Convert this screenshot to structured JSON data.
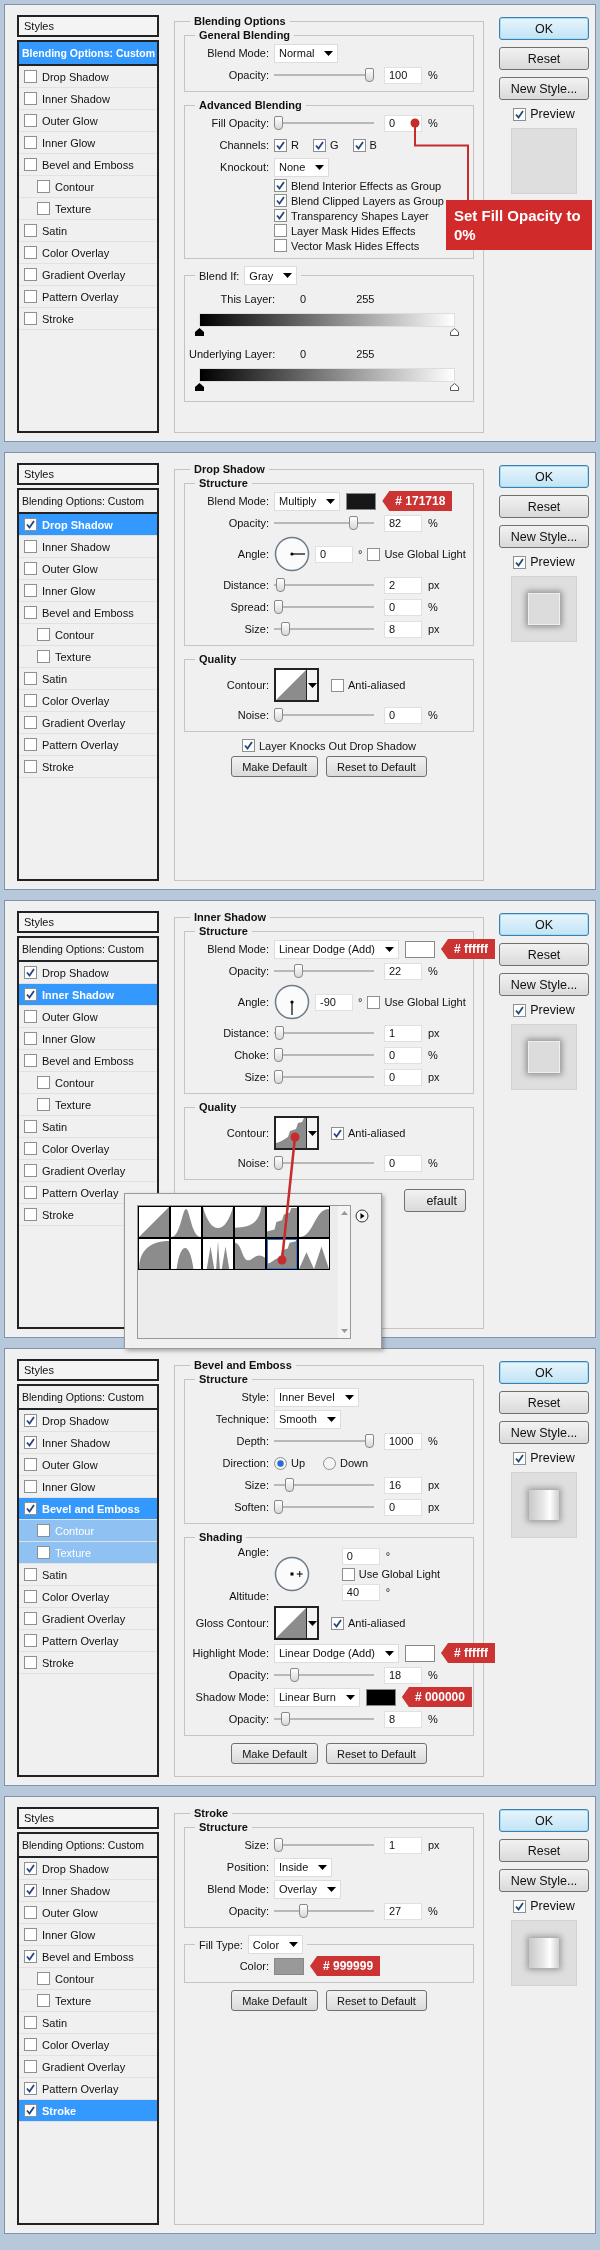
{
  "dialogs": [
    {
      "styles": {
        "header": "Styles",
        "options": {
          "label": "Blending Options: Custom",
          "selected": true
        },
        "effects": [
          {
            "label": "Drop Shadow",
            "kind": "effect",
            "checked": false,
            "selected": false
          },
          {
            "label": "Inner Shadow",
            "kind": "effect",
            "checked": false,
            "selected": false
          },
          {
            "label": "Outer Glow",
            "kind": "effect",
            "checked": false,
            "selected": false
          },
          {
            "label": "Inner Glow",
            "kind": "effect",
            "checked": false,
            "selected": false
          },
          {
            "label": "Bevel and Emboss",
            "kind": "effect",
            "checked": false,
            "selected": false
          },
          {
            "label": "Contour",
            "kind": "sub",
            "checked": false,
            "selected": false
          },
          {
            "label": "Texture",
            "kind": "sub",
            "checked": false,
            "selected": false
          },
          {
            "label": "Satin",
            "kind": "effect",
            "checked": false,
            "selected": false
          },
          {
            "label": "Color Overlay",
            "kind": "effect",
            "checked": false,
            "selected": false
          },
          {
            "label": "Gradient Overlay",
            "kind": "effect",
            "checked": false,
            "selected": false
          },
          {
            "label": "Pattern Overlay",
            "kind": "effect",
            "checked": false,
            "selected": false
          },
          {
            "label": "Stroke",
            "kind": "effect",
            "checked": false,
            "selected": false
          }
        ]
      },
      "panel": {
        "title": "Blending Options",
        "groups": [
          {
            "title": "General Blending",
            "rows": [
              {
                "kind": "select",
                "label": "Blend Mode:",
                "value": "Normal"
              },
              {
                "kind": "slider",
                "label": "Opacity:",
                "level": 1,
                "value": "100",
                "unit": "%"
              }
            ]
          },
          {
            "title": "Advanced Blending",
            "rows": [
              {
                "kind": "slider",
                "label": "Fill Opacity:",
                "level": 0,
                "value": "0",
                "unit": "%",
                "callout": {
                  "text": "Set Fill Opacity to 0%"
                }
              },
              {
                "kind": "channels",
                "label": "Channels:",
                "options": [
                  {
                    "label": "R",
                    "checked": true
                  },
                  {
                    "label": "G",
                    "checked": true
                  },
                  {
                    "label": "B",
                    "checked": true
                  }
                ]
              },
              {
                "kind": "select",
                "label": "Knockout:",
                "value": "None"
              },
              {
                "kind": "checkbox",
                "label": "Blend Interior Effects as Group",
                "checked": true
              },
              {
                "kind": "checkbox",
                "label": "Blend Clipped Layers as Group",
                "checked": true
              },
              {
                "kind": "checkbox",
                "label": "Transparency Shapes Layer",
                "checked": true
              },
              {
                "kind": "checkbox",
                "label": "Layer Mask Hides Effects",
                "checked": false
              },
              {
                "kind": "checkbox",
                "label": "Vector Mask Hides Effects",
                "checked": false
              }
            ]
          },
          {
            "legend": {
              "label": "Blend If:",
              "value": "Gray"
            },
            "rows": [
              {
                "kind": "gradient",
                "label": "This Layer:",
                "min": "0",
                "max": "255"
              },
              {
                "kind": "gradient",
                "label": "Underlying Layer:",
                "min": "0",
                "max": "255"
              }
            ]
          }
        ]
      },
      "buttons": [
        {
          "label": "OK",
          "default": true
        },
        {
          "label": "Reset",
          "default": false
        },
        {
          "label": "New Style...",
          "default": false
        }
      ],
      "preview": {
        "label": "Preview",
        "checked": true,
        "kind": "empty"
      }
    },
    {
      "styles": {
        "header": "Styles",
        "options": {
          "label": "Blending Options: Custom",
          "selected": false
        },
        "effects": [
          {
            "label": "Drop Shadow",
            "kind": "effect",
            "checked": true,
            "selected": true
          },
          {
            "label": "Inner Shadow",
            "kind": "effect",
            "checked": false,
            "selected": false
          },
          {
            "label": "Outer Glow",
            "kind": "effect",
            "checked": false,
            "selected": false
          },
          {
            "label": "Inner Glow",
            "kind": "effect",
            "checked": false,
            "selected": false
          },
          {
            "label": "Bevel and Emboss",
            "kind": "effect",
            "checked": false,
            "selected": false
          },
          {
            "label": "Contour",
            "kind": "sub",
            "checked": false,
            "selected": false
          },
          {
            "label": "Texture",
            "kind": "sub",
            "checked": false,
            "selected": false
          },
          {
            "label": "Satin",
            "kind": "effect",
            "checked": false,
            "selected": false
          },
          {
            "label": "Color Overlay",
            "kind": "effect",
            "checked": false,
            "selected": false
          },
          {
            "label": "Gradient Overlay",
            "kind": "effect",
            "checked": false,
            "selected": false
          },
          {
            "label": "Pattern Overlay",
            "kind": "effect",
            "checked": false,
            "selected": false
          },
          {
            "label": "Stroke",
            "kind": "effect",
            "checked": false,
            "selected": false
          }
        ]
      },
      "panel": {
        "title": "Drop Shadow",
        "groups": [
          {
            "title": "Structure",
            "rows": [
              {
                "kind": "select",
                "label": "Blend Mode:",
                "value": "Multiply",
                "swatch": {
                  "color": "#171718",
                  "tag": "# 171718"
                }
              },
              {
                "kind": "slider",
                "label": "Opacity:",
                "level": 0.82,
                "value": "82",
                "unit": "%"
              },
              {
                "kind": "angle",
                "label": "Angle:",
                "value": "0",
                "unit": "°",
                "checkbox": {
                  "label": "Use Global Light",
                  "checked": false
                }
              },
              {
                "kind": "slider",
                "label": "Distance:",
                "level": 0.02,
                "value": "2",
                "unit": "px"
              },
              {
                "kind": "slider",
                "label": "Spread:",
                "level": 0,
                "value": "0",
                "unit": "%"
              },
              {
                "kind": "slider",
                "label": "Size:",
                "level": 0.08,
                "value": "8",
                "unit": "px"
              }
            ]
          },
          {
            "title": "Quality",
            "rows": [
              {
                "kind": "contour",
                "label": "Contour:",
                "curve": {
                  "kind": "linear"
                },
                "checkbox": {
                  "label": "Anti-aliased",
                  "checked": false
                }
              },
              {
                "kind": "slider",
                "label": "Noise:",
                "level": 0,
                "value": "0",
                "unit": "%"
              }
            ]
          }
        ],
        "footer": {
          "checkbox": {
            "label": "Layer Knocks Out Drop Shadow",
            "checked": true
          },
          "buttons": [
            {
              "label": "Make Default"
            },
            {
              "label": "Reset to Default"
            }
          ]
        }
      },
      "buttons": [
        {
          "label": "OK",
          "default": true
        },
        {
          "label": "Reset",
          "default": false
        },
        {
          "label": "New Style...",
          "default": false
        }
      ],
      "preview": {
        "label": "Preview",
        "checked": true,
        "kind": "shadow"
      }
    },
    {
      "styles": {
        "header": "Styles",
        "options": {
          "label": "Blending Options: Custom",
          "selected": false
        },
        "effects": [
          {
            "label": "Drop Shadow",
            "kind": "effect",
            "checked": true,
            "selected": false
          },
          {
            "label": "Inner Shadow",
            "kind": "effect",
            "checked": true,
            "selected": true
          },
          {
            "label": "Outer Glow",
            "kind": "effect",
            "checked": false,
            "selected": false
          },
          {
            "label": "Inner Glow",
            "kind": "effect",
            "checked": false,
            "selected": false
          },
          {
            "label": "Bevel and Emboss",
            "kind": "effect",
            "checked": false,
            "selected": false
          },
          {
            "label": "Contour",
            "kind": "sub",
            "checked": false,
            "selected": false
          },
          {
            "label": "Texture",
            "kind": "sub",
            "checked": false,
            "selected": false
          },
          {
            "label": "Satin",
            "kind": "effect",
            "checked": false,
            "selected": false
          },
          {
            "label": "Color Overlay",
            "kind": "effect",
            "checked": false,
            "selected": false
          },
          {
            "label": "Gradient Overlay",
            "kind": "effect",
            "checked": false,
            "selected": false
          },
          {
            "label": "Pattern Overlay",
            "kind": "effect",
            "checked": false,
            "selected": false
          },
          {
            "label": "Stroke",
            "kind": "effect",
            "checked": false,
            "selected": false
          }
        ]
      },
      "panel": {
        "title": "Inner Shadow",
        "groups": [
          {
            "title": "Structure",
            "rows": [
              {
                "kind": "select",
                "label": "Blend Mode:",
                "value": "Linear Dodge (Add)",
                "swatch": {
                  "color": "#ffffff",
                  "tag": "# ffffff"
                }
              },
              {
                "kind": "slider",
                "label": "Opacity:",
                "level": 0.22,
                "value": "22",
                "unit": "%"
              },
              {
                "kind": "angle",
                "label": "Angle:",
                "value": "-90",
                "unit": "°",
                "checkbox": {
                  "label": "Use Global Light",
                  "checked": false
                }
              },
              {
                "kind": "slider",
                "label": "Distance:",
                "level": 0.01,
                "value": "1",
                "unit": "px"
              },
              {
                "kind": "slider",
                "label": "Choke:",
                "level": 0,
                "value": "0",
                "unit": "%"
              },
              {
                "kind": "slider",
                "label": "Size:",
                "level": 0,
                "value": "0",
                "unit": "px"
              }
            ]
          },
          {
            "title": "Quality",
            "rows": [
              {
                "kind": "contour",
                "label": "Contour:",
                "curve": {
                  "kind": "rolling"
                },
                "pointer": true,
                "checkbox": {
                  "label": "Anti-aliased",
                  "checked": true
                }
              },
              {
                "kind": "slider",
                "label": "Noise:",
                "level": 0,
                "value": "0",
                "unit": "%"
              }
            ]
          }
        ],
        "footer": {
          "buttons": [
            {
              "label": "efault",
              "kind": "partial"
            }
          ]
        }
      },
      "popup": {
        "kind": "contour-picker",
        "presets": [
          {
            "selected": false
          },
          {
            "selected": false
          },
          {
            "selected": false
          },
          {
            "selected": false
          },
          {
            "selected": false
          },
          {
            "selected": false
          },
          {
            "selected": false
          },
          {
            "selected": false
          },
          {
            "selected": false
          },
          {
            "selected": false
          },
          {
            "selected": true
          },
          {
            "selected": false
          }
        ]
      },
      "buttons": [
        {
          "label": "OK",
          "default": true
        },
        {
          "label": "Reset",
          "default": false
        },
        {
          "label": "New Style...",
          "default": false
        }
      ],
      "preview": {
        "label": "Preview",
        "checked": true,
        "kind": "shadow"
      }
    },
    {
      "styles": {
        "header": "Styles",
        "options": {
          "label": "Blending Options: Custom",
          "selected": false
        },
        "effects": [
          {
            "label": "Drop Shadow",
            "kind": "effect",
            "checked": true,
            "selected": false,
            "highlighted": false
          },
          {
            "label": "Inner Shadow",
            "kind": "effect",
            "checked": true,
            "selected": false,
            "highlighted": false
          },
          {
            "label": "Outer Glow",
            "kind": "effect",
            "checked": false,
            "selected": false,
            "highlighted": false
          },
          {
            "label": "Inner Glow",
            "kind": "effect",
            "checked": false,
            "selected": false,
            "highlighted": false
          },
          {
            "label": "Bevel and Emboss",
            "kind": "effect",
            "checked": true,
            "selected": true,
            "highlighted": false
          },
          {
            "label": "Contour",
            "kind": "sub",
            "checked": false,
            "selected": false,
            "highlighted": true
          },
          {
            "label": "Texture",
            "kind": "sub",
            "checked": false,
            "selected": false,
            "highlighted": true
          },
          {
            "label": "Satin",
            "kind": "effect",
            "checked": false,
            "selected": false,
            "highlighted": false
          },
          {
            "label": "Color Overlay",
            "kind": "effect",
            "checked": false,
            "selected": false,
            "highlighted": false
          },
          {
            "label": "Gradient Overlay",
            "kind": "effect",
            "checked": false,
            "selected": false,
            "highlighted": false
          },
          {
            "label": "Pattern Overlay",
            "kind": "effect",
            "checked": false,
            "selected": false,
            "highlighted": false
          },
          {
            "label": "Stroke",
            "kind": "effect",
            "checked": false,
            "selected": false,
            "highlighted": false
          }
        ]
      },
      "panel": {
        "title": "Bevel and Emboss",
        "groups": [
          {
            "title": "Structure",
            "rows": [
              {
                "kind": "select",
                "label": "Style:",
                "value": "Inner Bevel"
              },
              {
                "kind": "select",
                "label": "Technique:",
                "value": "Smooth"
              },
              {
                "kind": "slider",
                "label": "Depth:",
                "level": 1,
                "value": "1000",
                "unit": "%"
              },
              {
                "kind": "radio",
                "label": "Direction:",
                "options": [
                  {
                    "label": "Up",
                    "selected": true
                  },
                  {
                    "label": "Down",
                    "selected": false
                  }
                ]
              },
              {
                "kind": "slider",
                "label": "Size:",
                "level": 0.12,
                "value": "16",
                "unit": "px"
              },
              {
                "kind": "slider",
                "label": "Soften:",
                "level": 0,
                "value": "0",
                "unit": "px"
              }
            ]
          },
          {
            "title": "Shading",
            "rows": [
              {
                "kind": "angle-altitude",
                "label": "Angle:",
                "value": "0",
                "unit": "°",
                "checkbox": {
                  "label": "Use Global Light",
                  "checked": false
                },
                "altitude": {
                  "label": "Altitude:",
                  "value": "40",
                  "unit": "°"
                }
              },
              {
                "kind": "contour",
                "label": "Gloss Contour:",
                "curve": {
                  "kind": "linear"
                },
                "checkbox": {
                  "label": "Anti-aliased",
                  "checked": true
                }
              },
              {
                "kind": "select",
                "label": "Highlight Mode:",
                "value": "Linear Dodge (Add)",
                "swatch": {
                  "color": "#ffffff",
                  "tag": "# ffffff"
                }
              },
              {
                "kind": "slider",
                "label": "Opacity:",
                "level": 0.18,
                "value": "18",
                "unit": "%"
              },
              {
                "kind": "select",
                "label": "Shadow Mode:",
                "value": "Linear Burn",
                "swatch": {
                  "color": "#000000",
                  "tag": "# 000000"
                }
              },
              {
                "kind": "slider",
                "label": "Opacity:",
                "level": 0.08,
                "value": "8",
                "unit": "%"
              }
            ]
          }
        ],
        "footer": {
          "buttons": [
            {
              "label": "Make Default"
            },
            {
              "label": "Reset to Default"
            }
          ]
        }
      },
      "buttons": [
        {
          "label": "OK",
          "default": true
        },
        {
          "label": "Reset",
          "default": false
        },
        {
          "label": "New Style...",
          "default": false
        }
      ],
      "preview": {
        "label": "Preview",
        "checked": true,
        "kind": "bevel"
      }
    },
    {
      "styles": {
        "header": "Styles",
        "options": {
          "label": "Blending Options: Custom",
          "selected": false
        },
        "effects": [
          {
            "label": "Drop Shadow",
            "kind": "effect",
            "checked": true,
            "selected": false
          },
          {
            "label": "Inner Shadow",
            "kind": "effect",
            "checked": true,
            "selected": false
          },
          {
            "label": "Outer Glow",
            "kind": "effect",
            "checked": false,
            "selected": false
          },
          {
            "label": "Inner Glow",
            "kind": "effect",
            "checked": false,
            "selected": false
          },
          {
            "label": "Bevel and Emboss",
            "kind": "effect",
            "checked": true,
            "selected": false
          },
          {
            "label": "Contour",
            "kind": "sub",
            "checked": false,
            "selected": false
          },
          {
            "label": "Texture",
            "kind": "sub",
            "checked": false,
            "selected": false
          },
          {
            "label": "Satin",
            "kind": "effect",
            "checked": false,
            "selected": false
          },
          {
            "label": "Color Overlay",
            "kind": "effect",
            "checked": false,
            "selected": false
          },
          {
            "label": "Gradient Overlay",
            "kind": "effect",
            "checked": false,
            "selected": false
          },
          {
            "label": "Pattern Overlay",
            "kind": "effect",
            "checked": true,
            "selected": false
          },
          {
            "label": "Stroke",
            "kind": "effect",
            "checked": true,
            "selected": true
          }
        ]
      },
      "panel": {
        "title": "Stroke",
        "groups": [
          {
            "title": "Structure",
            "rows": [
              {
                "kind": "slider",
                "label": "Size:",
                "level": 0,
                "value": "1",
                "unit": "px"
              },
              {
                "kind": "select",
                "label": "Position:",
                "value": "Inside"
              },
              {
                "kind": "select",
                "label": "Blend Mode:",
                "value": "Overlay"
              },
              {
                "kind": "slider",
                "label": "Opacity:",
                "level": 0.27,
                "value": "27",
                "unit": "%"
              }
            ]
          },
          {
            "legend": {
              "label": "Fill Type:",
              "value": "Color"
            },
            "rows": [
              {
                "kind": "color",
                "label": "Color:",
                "swatch": {
                  "color": "#999999",
                  "tag": "# 999999"
                }
              }
            ]
          }
        ],
        "footer": {
          "buttons": [
            {
              "label": "Make Default"
            },
            {
              "label": "Reset to Default"
            }
          ]
        }
      },
      "buttons": [
        {
          "label": "OK",
          "default": true
        },
        {
          "label": "Reset",
          "default": false
        },
        {
          "label": "New Style...",
          "default": false
        }
      ],
      "preview": {
        "label": "Preview",
        "checked": true,
        "kind": "bevel"
      }
    }
  ]
}
